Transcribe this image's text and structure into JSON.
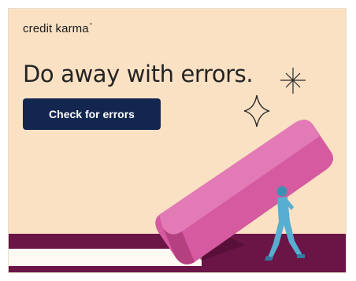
{
  "ad": {
    "brand": "credit karma",
    "brand_mark": "°",
    "headline": "Do away with errors.",
    "cta_label": "Check for errors"
  },
  "colors": {
    "background": "#fbe1c4",
    "cta": "#13264f",
    "floor": "#6b1446",
    "eraser": "#d65aa0",
    "figure": "#57aed0"
  },
  "icons": [
    "sparkle-icon",
    "star-outline-icon"
  ]
}
